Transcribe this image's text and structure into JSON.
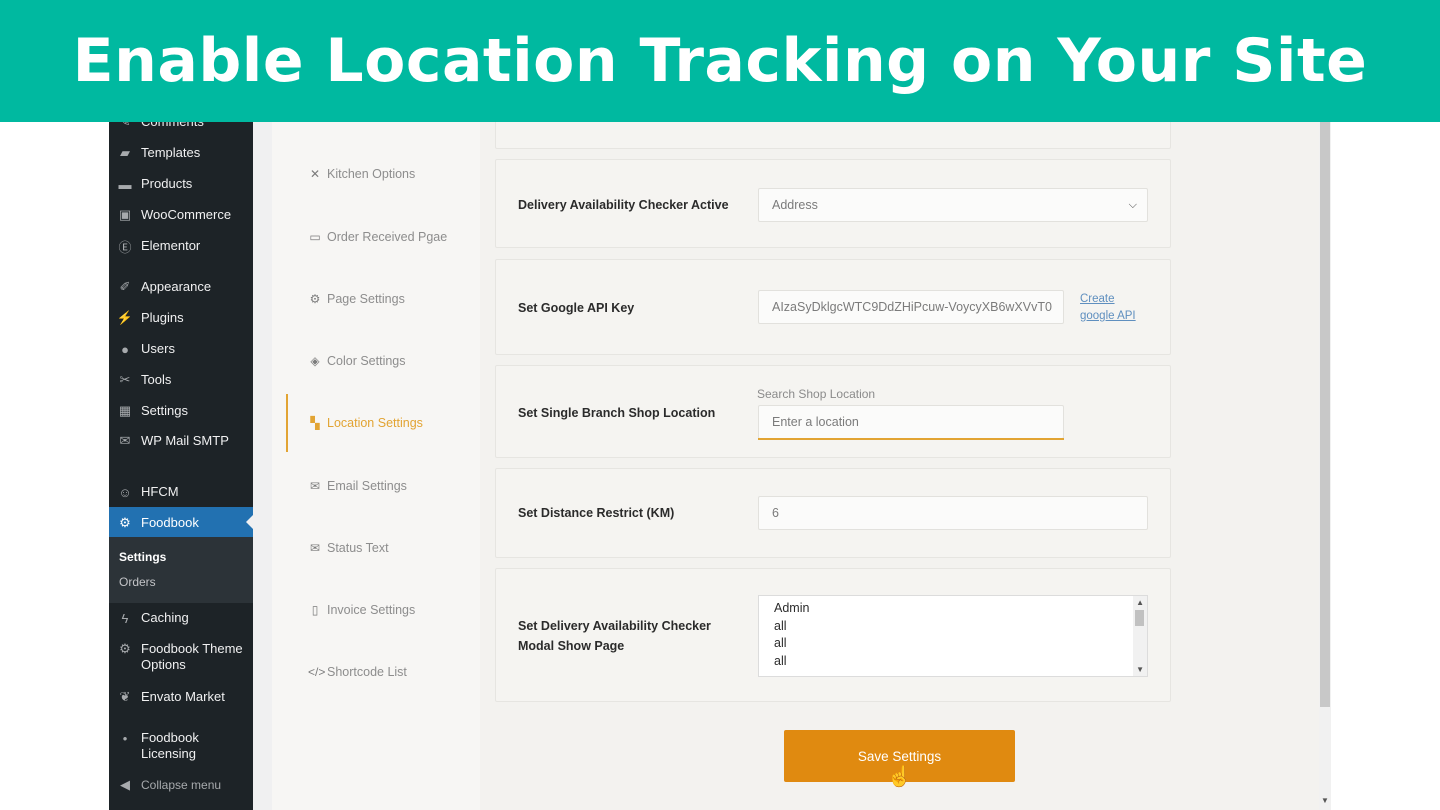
{
  "banner": {
    "title": "Enable Location Tracking on Your Site"
  },
  "wp_sidebar": {
    "items": [
      {
        "label": "Comments",
        "icon": "comment-icon"
      },
      {
        "label": "Templates",
        "icon": "folder-icon"
      },
      {
        "label": "Products",
        "icon": "archive-icon"
      },
      {
        "label": "WooCommerce",
        "icon": "woo-icon"
      },
      {
        "label": "Elementor",
        "icon": "elementor-icon"
      },
      {
        "label": "Appearance",
        "icon": "brush-icon"
      },
      {
        "label": "Plugins",
        "icon": "plug-icon"
      },
      {
        "label": "Users",
        "icon": "user-icon"
      },
      {
        "label": "Tools",
        "icon": "wrench-icon"
      },
      {
        "label": "Settings",
        "icon": "settings-grid-icon"
      },
      {
        "label": "WP Mail SMTP",
        "icon": "mail-icon"
      },
      {
        "label": "HFCM",
        "icon": "robot-icon"
      },
      {
        "label": "Foodbook",
        "icon": "gear-icon"
      },
      {
        "label": "Caching",
        "icon": "lightning-icon"
      },
      {
        "label": "Foodbook Theme Options",
        "icon": "gear-icon"
      },
      {
        "label": "Envato Market",
        "icon": "leaf-icon"
      },
      {
        "label": "Foodbook Licensing",
        "icon": "circle-icon"
      },
      {
        "label": "Collapse menu",
        "icon": "collapse-icon"
      }
    ],
    "submenu": [
      {
        "label": "Settings"
      },
      {
        "label": "Orders"
      }
    ]
  },
  "plugin_nav": {
    "items": [
      {
        "label": "Kitchen Options",
        "icon": "tools-icon"
      },
      {
        "label": "Order Received Pgae",
        "icon": "receipt-icon"
      },
      {
        "label": "Page Settings",
        "icon": "gear-icon"
      },
      {
        "label": "Color Settings",
        "icon": "paint-bucket-icon"
      },
      {
        "label": "Location Settings",
        "icon": "map-icon"
      },
      {
        "label": "Email Settings",
        "icon": "envelope-icon"
      },
      {
        "label": "Status Text",
        "icon": "envelope-icon"
      },
      {
        "label": "Invoice Settings",
        "icon": "file-icon"
      },
      {
        "label": "Shortcode List",
        "icon": "code-icon"
      }
    ],
    "active": "Location Settings"
  },
  "settings": {
    "delivery_checker": {
      "label": "Delivery Availability Checker Active",
      "selected": "Address"
    },
    "google_api": {
      "label": "Set Google API Key",
      "value": "AIzaSyDklgcWTC9DdZHiPcuw-VoycyXB6wXVvT0",
      "link": "Create google API"
    },
    "branch_location": {
      "label": "Set Single Branch Shop Location",
      "sublabel": "Search Shop Location",
      "placeholder": "Enter a location"
    },
    "distance": {
      "label": "Set Distance Restrict (KM)",
      "value": "6"
    },
    "modal_page": {
      "label": "Set Delivery Availability Checker Modal Show Page",
      "options": [
        "Admin",
        "all",
        "all",
        "all"
      ]
    }
  },
  "save_button": {
    "label": "Save Settings"
  },
  "colors": {
    "banner": "#00b9a0",
    "accent": "#e2a433",
    "save_button": "#e08a10",
    "wp_active": "#2271b1",
    "wp_sidebar": "#1d2327"
  }
}
